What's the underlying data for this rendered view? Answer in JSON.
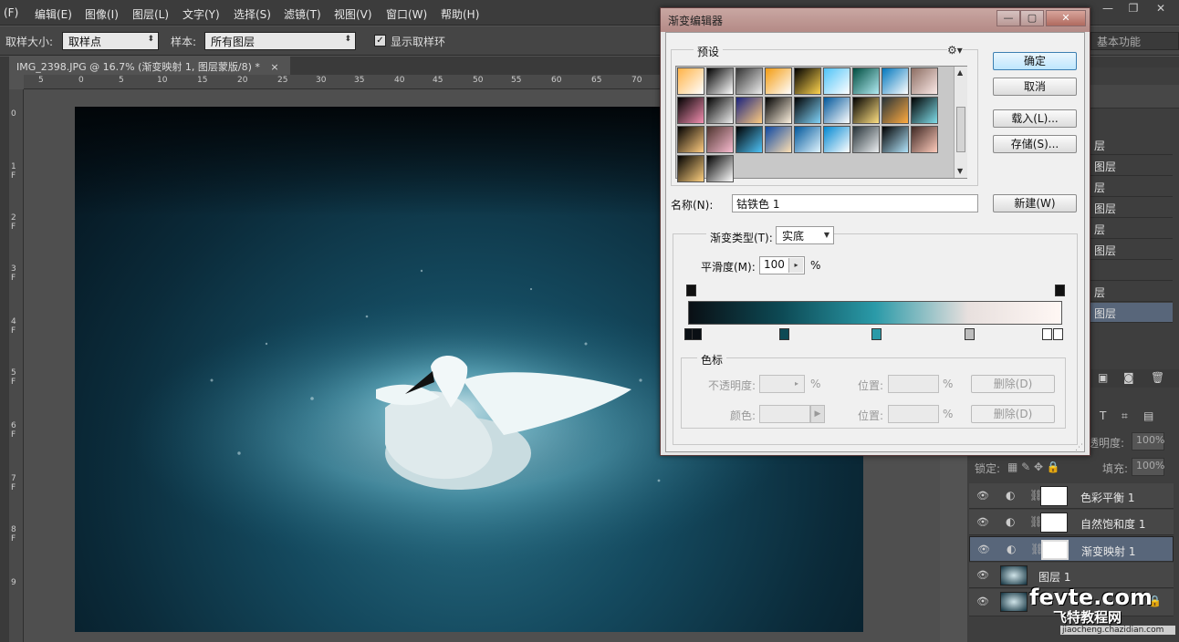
{
  "menu": {
    "items": [
      "(F)",
      "编辑(E)",
      "图像(I)",
      "图层(L)",
      "文字(Y)",
      "选择(S)",
      "滤镜(T)",
      "视图(V)",
      "窗口(W)",
      "帮助(H)"
    ]
  },
  "options": {
    "sample_size_label": "取样大小:",
    "sample_size_value": "取样点",
    "sample_label": "样本:",
    "sample_value": "所有图层",
    "show_ring_label": "显示取样环"
  },
  "workspace": {
    "label": "基本功能"
  },
  "document": {
    "tab_title": "IMG_2398.JPG @ 16.7% (渐变映射 1, 图层蒙版/8) *"
  },
  "rulers": {
    "h": [
      "5",
      "0",
      "5",
      "10",
      "15",
      "20",
      "25",
      "30",
      "35",
      "40",
      "45",
      "50",
      "55",
      "60",
      "65",
      "70"
    ],
    "v": [
      "0",
      "1\nF",
      "2\nF",
      "3\nF",
      "4\nF",
      "5\nF",
      "6\nF",
      "7\nF",
      "8\nF",
      "9"
    ]
  },
  "dialog": {
    "title": "渐变编辑器",
    "presets_label": "预设",
    "buttons": {
      "ok": "确定",
      "cancel": "取消",
      "load": "载入(L)...",
      "save": "存储(S)...",
      "new": "新建(W)"
    },
    "name_label": "名称(N):",
    "name_value": "钴铁色 1",
    "type_label": "渐变类型(T):",
    "type_value": "实底",
    "smooth_label": "平滑度(M):",
    "smooth_value": "100",
    "smooth_unit": "%",
    "stops_group": "色标",
    "opacity_label": "不透明度:",
    "percent": "%",
    "location_label": "位置:",
    "delete_label": "删除(D)",
    "color_label": "颜色:",
    "gradient_colors": [
      "#0a0f14",
      "#0d4a55",
      "#2a9aa8",
      "#e8e0de",
      "#fff7f4"
    ]
  },
  "layers_panel": {
    "opacity_label": "透明度:",
    "opacity_value": "100%",
    "lock_label": "锁定:",
    "fill_label": "填充:",
    "fill_value": "100%",
    "partial_names": [
      "层",
      "图层",
      "层",
      "图层",
      "层",
      "图层",
      "层",
      "层",
      "图层"
    ],
    "layers": [
      {
        "name": "色彩平衡 1"
      },
      {
        "name": "自然饱和度 1"
      },
      {
        "name": "渐变映射 1"
      },
      {
        "name": "图层 1"
      },
      {
        "name": ""
      }
    ]
  },
  "watermark": {
    "brand": "fevte.com",
    "cn": "飞特教程网",
    "url": "jiaocheng.chazidian.com"
  }
}
